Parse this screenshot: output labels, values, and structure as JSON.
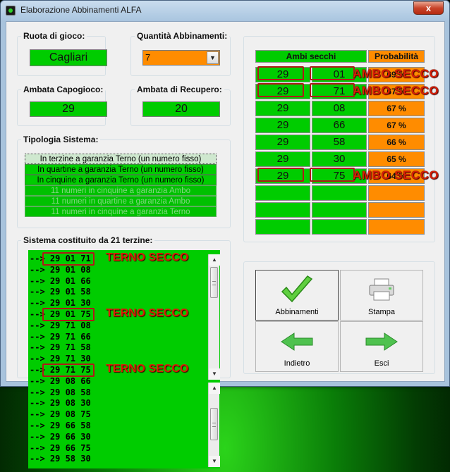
{
  "window": {
    "title": "Elaborazione Abbinamenti ALFA",
    "close_glyph": "x"
  },
  "ruota": {
    "label": "Ruota di gioco:",
    "value": "Cagliari"
  },
  "quantita": {
    "label": "Quantità Abbinamenti:",
    "value": "7",
    "arrow_glyph": "▼"
  },
  "capogioco": {
    "label": "Ambata Capogioco:",
    "value": "29"
  },
  "recupero": {
    "label": "Ambata di Recupero:",
    "value": "20"
  },
  "tipologia": {
    "label": "Tipologia Sistema:",
    "options": [
      {
        "text": "In terzine a garanzia Terno (un numero fisso)",
        "state": "sel"
      },
      {
        "text": "In quartine a garanzia Terno (un numero fisso)",
        "state": "active"
      },
      {
        "text": "In cinquine a garanzia Terno (un numero fisso)",
        "state": "active"
      },
      {
        "text": "11 numeri in cinquine a garanzia Ambo",
        "state": "disabled"
      },
      {
        "text": "11 numeri in quartine a garanzia Ambo",
        "state": "disabled"
      },
      {
        "text": "11 numeri in cinquine a garanzia Terno",
        "state": "disabled"
      }
    ]
  },
  "ambi": {
    "header": "Ambi secchi",
    "prob_header": "Probabilità",
    "rows": [
      {
        "a": "29",
        "b": "01",
        "p": "69 %"
      },
      {
        "a": "29",
        "b": "71",
        "p": "67 %"
      },
      {
        "a": "29",
        "b": "08",
        "p": "67 %"
      },
      {
        "a": "29",
        "b": "66",
        "p": "67 %"
      },
      {
        "a": "29",
        "b": "58",
        "p": "66 %"
      },
      {
        "a": "29",
        "b": "30",
        "p": "65 %"
      },
      {
        "a": "29",
        "b": "75",
        "p": "64 %"
      },
      {
        "a": "",
        "b": "",
        "p": ""
      },
      {
        "a": "",
        "b": "",
        "p": ""
      },
      {
        "a": "",
        "b": "",
        "p": ""
      }
    ],
    "annotation": "AMBO SECCO"
  },
  "sistema": {
    "label": "Sistema costituito da 21 terzine:",
    "rows": [
      "--> 29 01 71",
      "--> 29 01 08",
      "--> 29 01 66",
      "--> 29 01 58",
      "--> 29 01 30",
      "--> 29 01 75",
      "--> 29 71 08",
      "--> 29 71 66",
      "--> 29 71 58",
      "--> 29 71 30",
      "--> 29 71 75"
    ],
    "overflow_rows": [
      "--> 29 08 66",
      "--> 29 08 58",
      "--> 29 08 30",
      "--> 29 08 75",
      "--> 29 66 58",
      "--> 29 66 30",
      "--> 29 66 75",
      "--> 29 58 30"
    ],
    "annotation": "TERNO SECCO"
  },
  "buttons": {
    "abbinamenti": "Abbinamenti",
    "stampa": "Stampa",
    "indietro": "Indietro",
    "esci": "Esci"
  },
  "colors": {
    "green": "#00cc00",
    "orange": "#ff8c00",
    "annotation_red": "#d81e06"
  }
}
